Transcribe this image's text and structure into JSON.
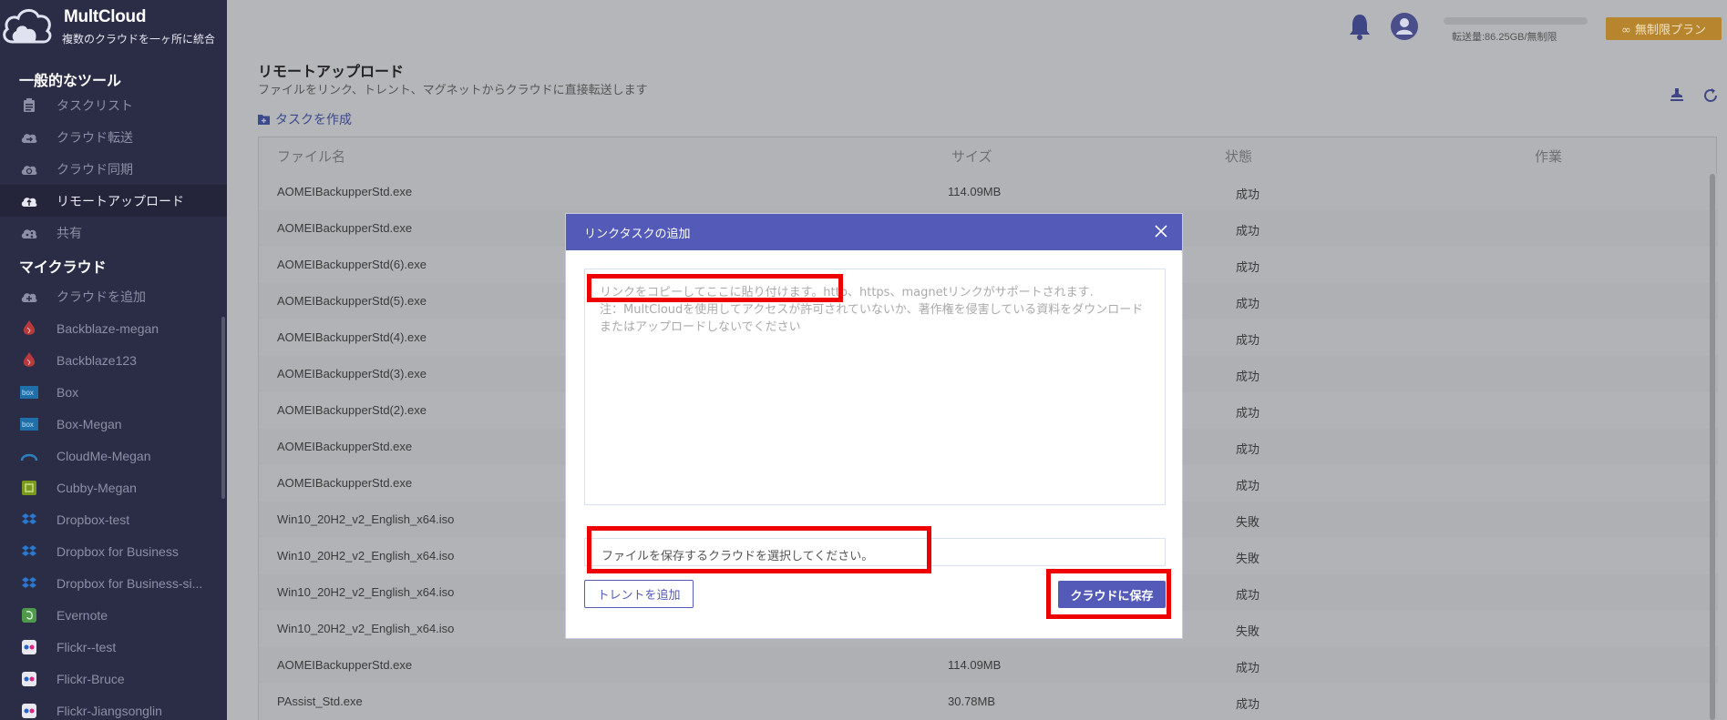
{
  "brand": {
    "name": "MultCloud",
    "tagline": "複数のクラウドを一ヶ所に統合"
  },
  "sidebar": {
    "section_tools": "一般的なツール",
    "tools": [
      {
        "label": "タスクリスト",
        "icon": "task-list-icon"
      },
      {
        "label": "クラウド転送",
        "icon": "cloud-transfer-icon"
      },
      {
        "label": "クラウド同期",
        "icon": "cloud-sync-icon"
      },
      {
        "label": "リモートアップロード",
        "icon": "remote-upload-icon",
        "active": true
      },
      {
        "label": "共有",
        "icon": "share-icon"
      }
    ],
    "section_clouds": "マイクラウド",
    "clouds": [
      {
        "label": "クラウドを追加",
        "icon": "add-cloud-icon"
      },
      {
        "label": "Backblaze-megan",
        "icon": "backblaze-icon"
      },
      {
        "label": "Backblaze123",
        "icon": "backblaze-icon"
      },
      {
        "label": "Box",
        "icon": "box-icon"
      },
      {
        "label": "Box-Megan",
        "icon": "box-icon"
      },
      {
        "label": "CloudMe-Megan",
        "icon": "cloudme-icon"
      },
      {
        "label": "Cubby-Megan",
        "icon": "cubby-icon"
      },
      {
        "label": "Dropbox-test",
        "icon": "dropbox-icon"
      },
      {
        "label": "Dropbox for Business",
        "icon": "dropbox-icon"
      },
      {
        "label": "Dropbox for Business-si...",
        "icon": "dropbox-icon"
      },
      {
        "label": "Evernote",
        "icon": "evernote-icon"
      },
      {
        "label": "Flickr--test",
        "icon": "flickr-icon"
      },
      {
        "label": "Flickr-Bruce",
        "icon": "flickr-icon"
      },
      {
        "label": "Flickr-Jiangsonglin",
        "icon": "flickr-icon"
      }
    ]
  },
  "header": {
    "transfer_text": "転送量:86.25GB/無制限",
    "plan_label": "∞ 無制限プラン"
  },
  "page": {
    "title": "リモートアップロード",
    "subtitle": "ファイルをリンク、トレント、マグネットからクラウドに直接転送します",
    "create_task": "タスクを作成"
  },
  "table": {
    "columns": [
      "ファイル名",
      "サイズ",
      "状態",
      "作業"
    ],
    "rows": [
      {
        "name": "AOMEIBackupperStd.exe",
        "size": "114.09MB",
        "status": "成功"
      },
      {
        "name": "AOMEIBackupperStd.exe",
        "size": "",
        "status": "成功"
      },
      {
        "name": "AOMEIBackupperStd(6).exe",
        "size": "",
        "status": "成功"
      },
      {
        "name": "AOMEIBackupperStd(5).exe",
        "size": "",
        "status": "成功"
      },
      {
        "name": "AOMEIBackupperStd(4).exe",
        "size": "",
        "status": "成功"
      },
      {
        "name": "AOMEIBackupperStd(3).exe",
        "size": "",
        "status": "成功"
      },
      {
        "name": "AOMEIBackupperStd(2).exe",
        "size": "",
        "status": "成功"
      },
      {
        "name": "AOMEIBackupperStd.exe",
        "size": "",
        "status": "成功"
      },
      {
        "name": "AOMEIBackupperStd.exe",
        "size": "",
        "status": "成功"
      },
      {
        "name": "Win10_20H2_v2_English_x64.iso",
        "size": "",
        "status": "失敗"
      },
      {
        "name": "Win10_20H2_v2_English_x64.iso",
        "size": "",
        "status": "失敗"
      },
      {
        "name": "Win10_20H2_v2_English_x64.iso",
        "size": "",
        "status": "成功"
      },
      {
        "name": "Win10_20H2_v2_English_x64.iso",
        "size": "",
        "status": "失敗"
      },
      {
        "name": "AOMEIBackupperStd.exe",
        "size": "114.09MB",
        "status": "成功"
      },
      {
        "name": "PAssist_Std.exe",
        "size": "30.78MB",
        "status": "成功"
      }
    ]
  },
  "modal": {
    "title": "リンクタスクの追加",
    "link_placeholder_line1": "リンクをコピーしてここに貼り付けます。http、https、magnetリンクがサポートされます.",
    "link_placeholder_line2": "注：MultCloudを使用してアクセスが許可されていないか、著作権を侵害している資料をダウンロードまたはアップロードしないでください",
    "save_field_placeholder": "ファイルを保存するクラウドを選択してください。",
    "torrent_button": "トレントを追加",
    "save_button": "クラウドに保存"
  },
  "colors": {
    "sidebar_bg": "#2b2d46",
    "accent": "#535ab8",
    "plan": "#b8852f",
    "highlight": "#ee0000"
  }
}
